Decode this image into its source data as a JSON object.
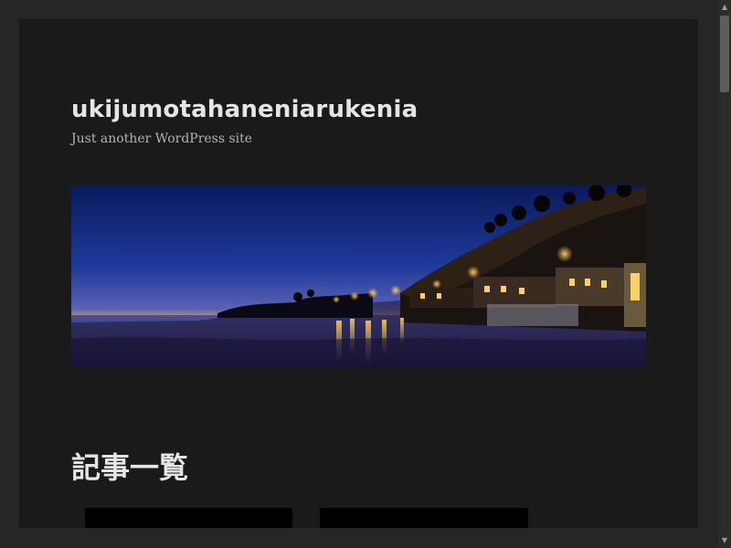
{
  "site": {
    "title": "ukijumotahaneniarukenia",
    "tagline": "Just another WordPress site"
  },
  "header_image": {
    "description_icon": "coastal-night-photo"
  },
  "main": {
    "section_heading": "記事一覧",
    "posts": [
      {
        "title": ""
      },
      {
        "title": ""
      }
    ]
  },
  "scrollbar": {
    "up_arrow": "▲",
    "down_arrow": "▼"
  },
  "colors": {
    "page_background": "#262626",
    "content_background": "#1a1a1a",
    "title_text": "#e5e5e5",
    "tagline_text": "#b3b3b3",
    "post_card_background": "#000000",
    "post_title_accent": "#f5e31f"
  }
}
